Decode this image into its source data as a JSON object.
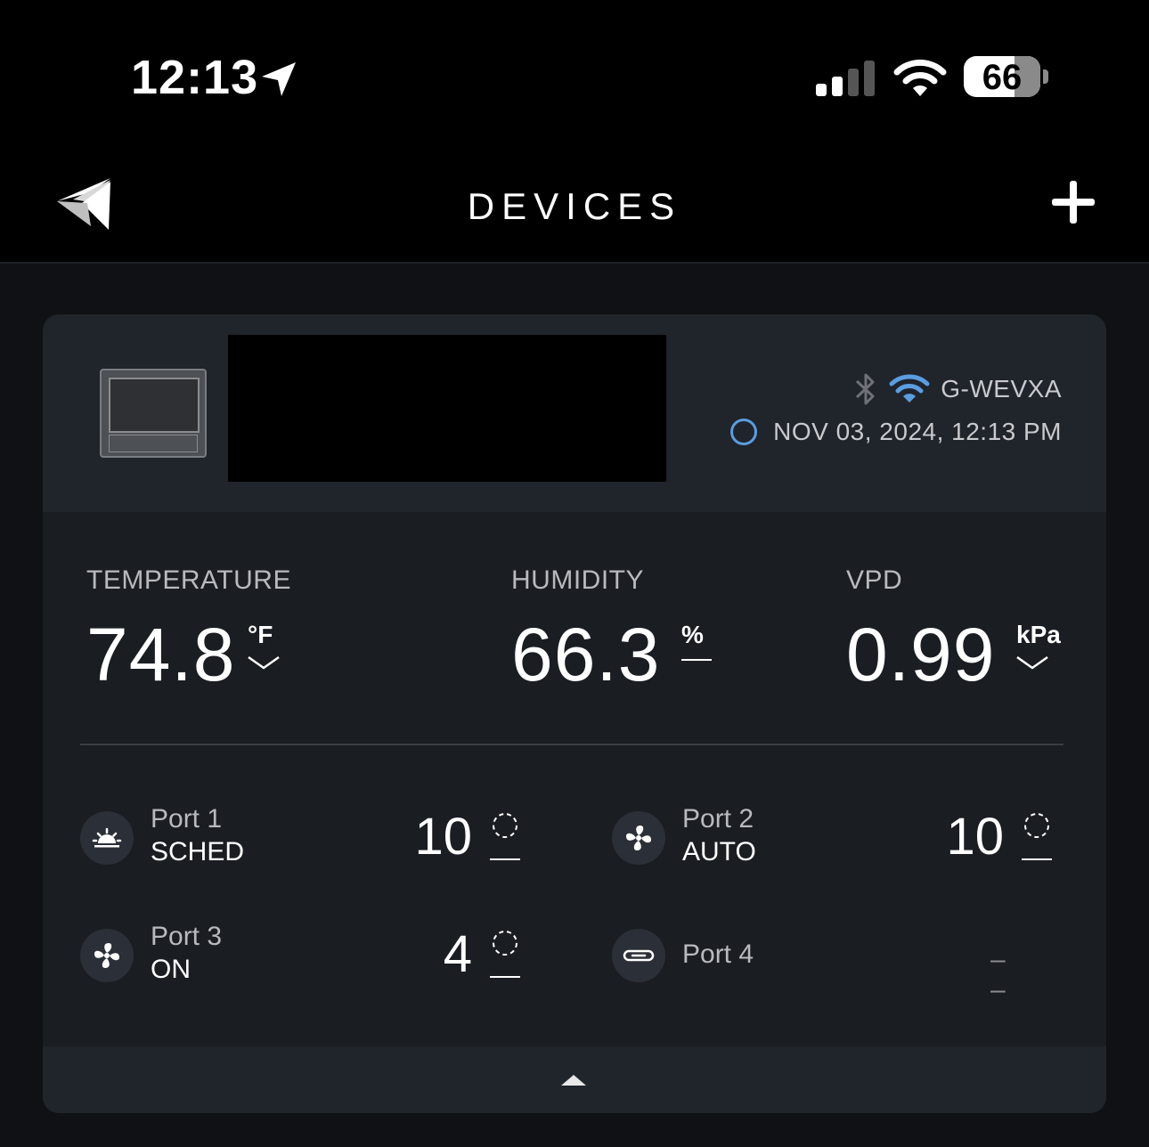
{
  "status_bar": {
    "time": "12:13",
    "battery_level": "66",
    "battery_fraction": 0.66
  },
  "nav": {
    "title": "DEVICES",
    "add_icon": "plus-icon",
    "logo_icon": "logo-icon"
  },
  "device": {
    "id": "G-WEVXA",
    "timestamp": "NOV 03, 2024, 12:13 PM",
    "colors": {
      "wifi": "#5a9de0",
      "status_ring": "#5a9de0"
    }
  },
  "metrics": [
    {
      "label": "TEMPERATURE",
      "value": "74.8",
      "unit": "°F",
      "control": "chevron-down"
    },
    {
      "label": "HUMIDITY",
      "value": "66.3",
      "unit": "%",
      "control": "dash"
    },
    {
      "label": "VPD",
      "value": "0.99",
      "unit": "kPa",
      "control": "chevron-down"
    }
  ],
  "ports": [
    {
      "name": "Port 1",
      "mode": "SCHED",
      "level": "10",
      "icon": "sunrise-icon"
    },
    {
      "name": "Port 2",
      "mode": "AUTO",
      "level": "10",
      "icon": "fan-icon"
    },
    {
      "name": "Port 3",
      "mode": "ON",
      "level": "4",
      "icon": "fan-icon"
    },
    {
      "name": "Port 4",
      "mode": "",
      "level": "– –",
      "icon": "unplugged-icon"
    }
  ]
}
